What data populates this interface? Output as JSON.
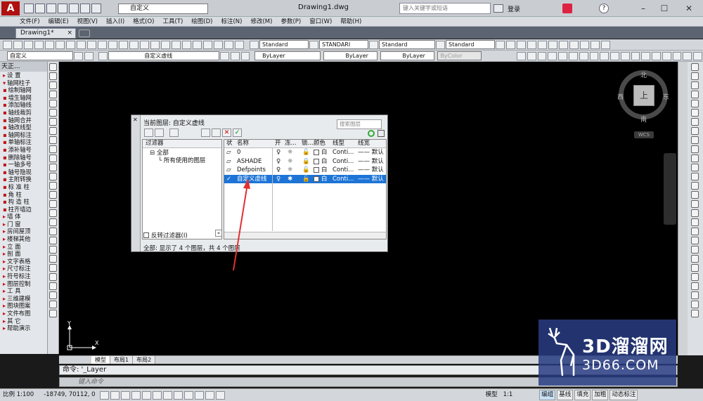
{
  "title_bar": {
    "workspace": "自定义",
    "document_title": "Drawing1.dwg",
    "search_placeholder": "键入关键字或短语",
    "login": "登录"
  },
  "menu": [
    "文件(F)",
    "编辑(E)",
    "视图(V)",
    "插入(I)",
    "格式(O)",
    "工具(T)",
    "绘图(D)",
    "标注(N)",
    "修改(M)",
    "参数(P)",
    "窗口(W)",
    "帮助(H)"
  ],
  "doc_tab": "Drawing1*",
  "styles_toolbar": {
    "text_style": "Standard",
    "dim_style": "STANDARI",
    "table_style": "Standard",
    "multileader_style": "Standard"
  },
  "props_toolbar": {
    "workspace_combo": "自定义",
    "layer_combo": "自定义虚线",
    "color": "ByLayer",
    "linetype": "ByLayer",
    "lineweight": "ByLayer",
    "plot_style": "ByColor"
  },
  "palette": {
    "header": "天正...",
    "items": [
      {
        "m": "▸",
        "t": "设  置"
      },
      {
        "m": "▾",
        "t": "轴网柱子"
      },
      {
        "m": "▪",
        "t": "绘制轴网"
      },
      {
        "m": "▪",
        "t": "墙生轴网"
      },
      {
        "m": "▪",
        "t": "添加轴线"
      },
      {
        "m": "▪",
        "t": "轴线裁剪"
      },
      {
        "m": "▪",
        "t": "轴网合并"
      },
      {
        "m": "▪",
        "t": "轴改线型"
      },
      {
        "m": "▪",
        "t": "轴网标注"
      },
      {
        "m": "▪",
        "t": "单轴标注"
      },
      {
        "m": "▪",
        "t": "添补轴号"
      },
      {
        "m": "▪",
        "t": "删除轴号"
      },
      {
        "m": "▪",
        "t": "一轴多号"
      },
      {
        "m": "▪",
        "t": "轴号隐现"
      },
      {
        "m": "▪",
        "t": "主附转换"
      },
      {
        "m": "▪",
        "t": "标 准 柱"
      },
      {
        "m": "▪",
        "t": "角    柱"
      },
      {
        "m": "▪",
        "t": "构 造 柱"
      },
      {
        "m": "▪",
        "t": "柱齐墙边"
      },
      {
        "m": "▸",
        "t": "墙    体"
      },
      {
        "m": "▸",
        "t": "门    窗"
      },
      {
        "m": "▸",
        "t": "房间屋顶"
      },
      {
        "m": "▸",
        "t": "楼梯其他"
      },
      {
        "m": "▸",
        "t": "立    面"
      },
      {
        "m": "▸",
        "t": "剖    面"
      },
      {
        "m": "▸",
        "t": "文字表格"
      },
      {
        "m": "▸",
        "t": "尺寸标注"
      },
      {
        "m": "▸",
        "t": "符号标注"
      },
      {
        "m": "▸",
        "t": "图层控制"
      },
      {
        "m": "▸",
        "t": "工    具"
      },
      {
        "m": "▸",
        "t": "三维建模"
      },
      {
        "m": "▸",
        "t": "图块图案"
      },
      {
        "m": "▸",
        "t": "文件布图"
      },
      {
        "m": "▸",
        "t": "其    它"
      },
      {
        "m": "▸",
        "t": "帮助演示"
      }
    ]
  },
  "viewcube": {
    "north": "北",
    "south": "南",
    "east": "东",
    "west": "西",
    "face": "上",
    "wcs": "WCS"
  },
  "layer_dialog": {
    "current_layer_label": "当前图层: 自定义虚线",
    "search_placeholder": "搜索图层",
    "filters_header": "过滤器",
    "tree_all": "全部",
    "tree_used": "所有使用的图层",
    "invert_filter": "反转过滤器(I)",
    "status": "全部: 显示了 4 个图层，共 4 个图层",
    "columns": [
      "状",
      "名称",
      "开",
      "冻...",
      "锁...",
      "颜色",
      "线型",
      "线宽"
    ],
    "layers": [
      {
        "status": "▱",
        "name": "0",
        "on": "♀",
        "freeze": "☼",
        "lock": "🔓",
        "color": "白",
        "linetype": "Conti...",
        "lineweight": "—— 默认",
        "selected": false
      },
      {
        "status": "▱",
        "name": "ASHADE",
        "on": "♀",
        "freeze": "☼",
        "lock": "🔒",
        "color": "白",
        "linetype": "Conti...",
        "lineweight": "—— 默认",
        "selected": false
      },
      {
        "status": "▱",
        "name": "Defpoints",
        "on": "♀",
        "freeze": "☼",
        "lock": "🔓",
        "color": "白",
        "linetype": "Conti...",
        "lineweight": "—— 默认",
        "selected": false
      },
      {
        "status": "✓",
        "name": "自定义虚线",
        "on": "♀",
        "freeze": "✱",
        "lock": "🔓",
        "color": "白",
        "linetype": "Conti...",
        "lineweight": "—— 默认",
        "selected": true
      }
    ]
  },
  "layout_tabs": [
    "模型",
    "布局1",
    "布局2"
  ],
  "command": {
    "history": "命令:  '_Layer",
    "prompt_placeholder": "键入命令"
  },
  "status_bar": {
    "scale": "比例 1:100",
    "coords": "-18749, 70112, 0",
    "model": "模型",
    "annot_scale": "1:1",
    "toggles": [
      "编组",
      "基线",
      "填充",
      "加粗",
      "动态标注"
    ]
  },
  "watermark": {
    "brand": "3D溜溜网",
    "domain": "3D66.COM"
  },
  "colors": {
    "canvas": "#000000",
    "selection": "#1d74d6",
    "logo": "#b01010",
    "arrow": "#e03030"
  }
}
